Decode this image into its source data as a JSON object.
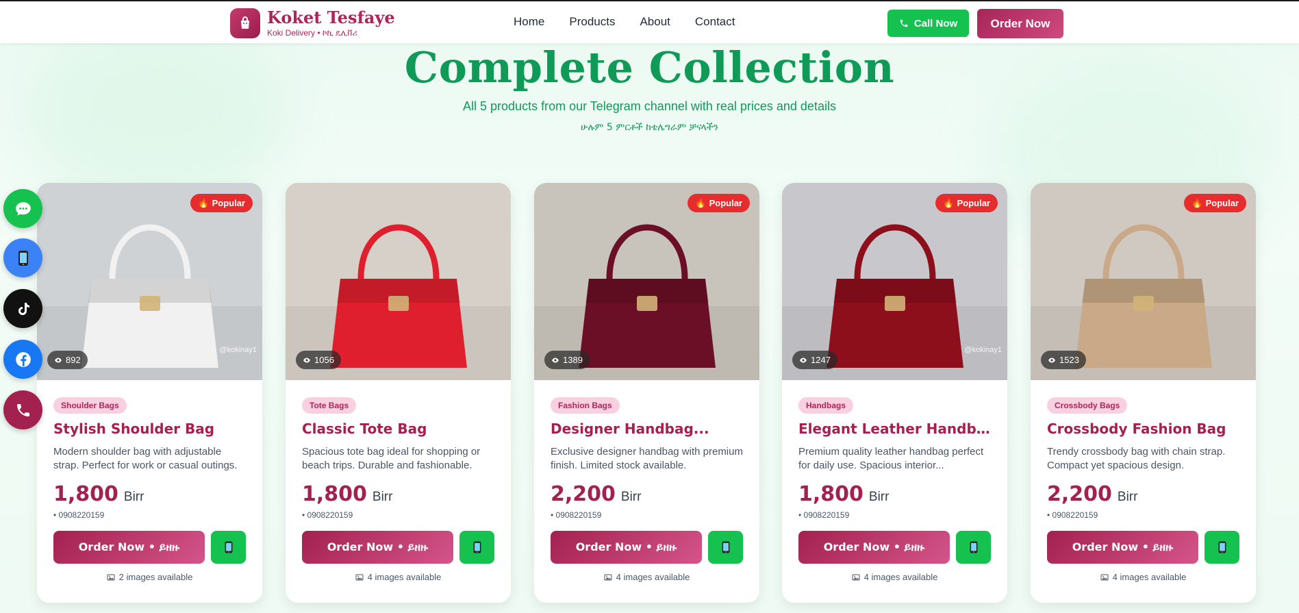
{
  "header": {
    "brand_title": "Koket Tesfaye",
    "brand_subtitle": "Koki Delivery • ኮኪ ዴሊቨሪ",
    "nav": [
      {
        "label": "Home"
      },
      {
        "label": "Products"
      },
      {
        "label": "About"
      },
      {
        "label": "Contact"
      }
    ],
    "call_label": "Call Now",
    "order_label": "Order Now"
  },
  "hero": {
    "title": "Complete Collection",
    "subtitle": "All 5 products from our Telegram channel with real prices and details",
    "subtitle_am": "ሁሉም 5 ምርቶች ከቴሌግራም ቻናላችን"
  },
  "floating": [
    {
      "icon": "chat-icon",
      "color": "#16c24f"
    },
    {
      "icon": "mobile-phone-icon",
      "color": "#3b82f6"
    },
    {
      "icon": "tiktok-icon",
      "color": "#111111"
    },
    {
      "icon": "facebook-icon",
      "color": "#1877f2"
    },
    {
      "icon": "phone-icon",
      "color": "#a3214f"
    }
  ],
  "products": [
    {
      "popular": "Popular",
      "views": "892",
      "watermark": "@kokinay1",
      "category": "Shoulder Bags",
      "name": "Stylish Shoulder Bag",
      "description": "Modern shoulder bag with adjustable strap. Perfect for work or casual outings.",
      "price": "1,800",
      "currency": "Birr",
      "phone": "• 0908220159",
      "order_label": "Order Now • ይዘዙ",
      "images_available": "2 images available",
      "bag_color": "#f1f1f1"
    },
    {
      "popular": "",
      "views": "1056",
      "watermark": "",
      "category": "Tote Bags",
      "name": "Classic Tote Bag",
      "description": "Spacious tote bag ideal for shopping or beach trips. Durable and fashionable.",
      "price": "1,800",
      "currency": "Birr",
      "phone": "• 0908220159",
      "order_label": "Order Now • ይዘዙ",
      "images_available": "4 images available",
      "bag_color": "#e01f2e"
    },
    {
      "popular": "Popular",
      "views": "1389",
      "watermark": "",
      "category": "Fashion Bags",
      "name": "Designer Handbag...",
      "description": "Exclusive designer handbag with premium finish. Limited stock available.",
      "price": "2,200",
      "currency": "Birr",
      "phone": "• 0908220159",
      "order_label": "Order Now • ይዘዙ",
      "images_available": "4 images available",
      "bag_color": "#6b0f26"
    },
    {
      "popular": "Popular",
      "views": "1247",
      "watermark": "@kokinay1",
      "category": "Handbags",
      "name": "Elegant Leather Handbag",
      "description": "Premium quality leather handbag perfect for daily use. Spacious interior...",
      "price": "1,800",
      "currency": "Birr",
      "phone": "• 0908220159",
      "order_label": "Order Now • ይዘዙ",
      "images_available": "4 images available",
      "bag_color": "#8e0f1c"
    },
    {
      "popular": "Popular",
      "views": "1523",
      "watermark": "",
      "category": "Crossbody Bags",
      "name": "Crossbody Fashion Bag",
      "description": "Trendy crossbody bag with chain strap. Compact yet spacious design.",
      "price": "2,200",
      "currency": "Birr",
      "phone": "• 0908220159",
      "order_label": "Order Now • ይዘዙ",
      "images_available": "4 images available",
      "bag_color": "#c9a987"
    }
  ]
}
